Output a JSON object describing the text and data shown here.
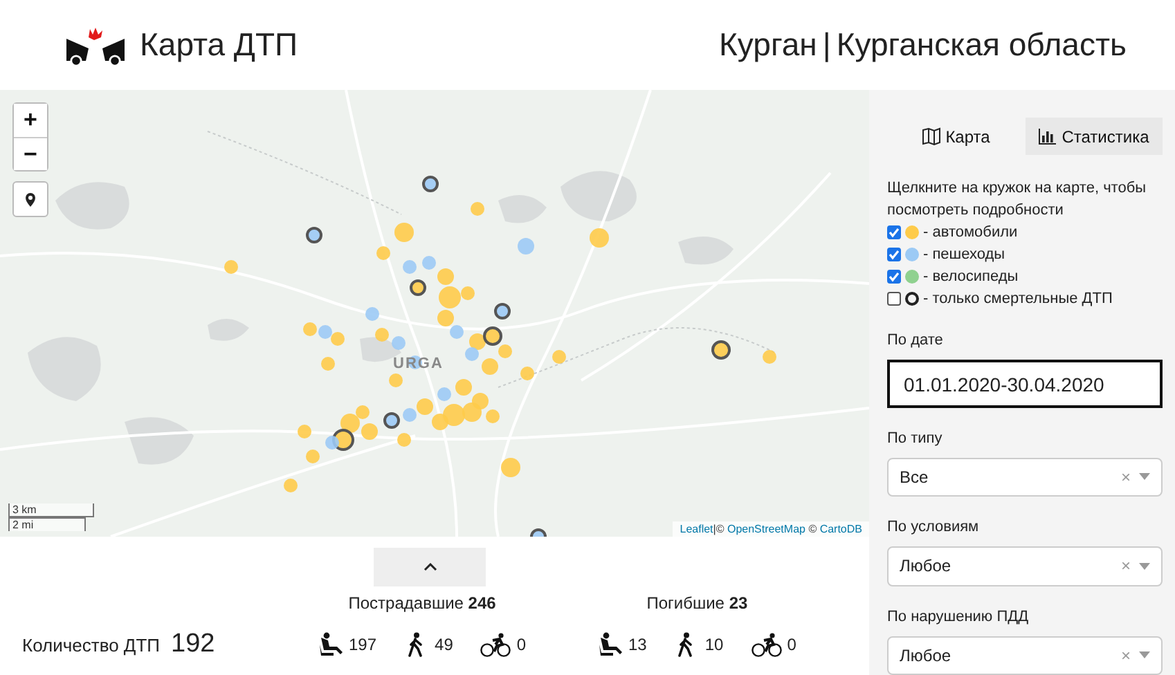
{
  "header": {
    "title": "Карта ДТП",
    "city": "Курган",
    "separator": "|",
    "region": "Курганская область"
  },
  "map": {
    "zoom_in": "+",
    "zoom_out": "−",
    "city_label": "URGA",
    "scale_metric": "3 km",
    "scale_imperial": "2 mi",
    "attribution": [
      {
        "text": "Leaflet",
        "kind": "link"
      },
      {
        "text": "|",
        "kind": "text"
      },
      {
        "text": "© ",
        "kind": "text"
      },
      {
        "text": "OpenStreetMap",
        "kind": "link"
      },
      {
        "text": " © ",
        "kind": "text"
      },
      {
        "text": "CartoDB",
        "kind": "link"
      }
    ]
  },
  "sidebar": {
    "tabs": [
      {
        "label": "Карта",
        "kind": "map",
        "selected": true
      },
      {
        "label": "Статистика",
        "kind": "chart",
        "selected": false
      }
    ],
    "hint": "Щелкните на кружок на карте, чтобы посмотреть подробности",
    "legend": [
      {
        "kind": "dot",
        "color": "#fecb4a",
        "label": "- автомобили",
        "checked": true
      },
      {
        "kind": "dot",
        "color": "#9ccaf5",
        "label": "- пешеходы",
        "checked": true
      },
      {
        "kind": "dot",
        "color": "#8fd18f",
        "label": "- велосипеды",
        "checked": true
      },
      {
        "kind": "ring",
        "color": "#222222",
        "label": "- только смертельные ДТП",
        "checked": false
      }
    ],
    "date_filter": {
      "label": "По дате",
      "value": "01.01.2020-30.04.2020"
    },
    "filters": [
      {
        "label": "По типу",
        "value": "Все",
        "clear": "×"
      },
      {
        "label": "По условиям",
        "value": "Любое",
        "clear": "×"
      },
      {
        "label": "По нарушению ПДД",
        "value": "Любое",
        "clear": "×"
      }
    ]
  },
  "stats": {
    "count_label": "Количество ДТП",
    "count": "192",
    "groups": [
      {
        "title": "Пострадавшие **246**",
        "items": [
          {
            "kind": "car",
            "value": "197"
          },
          {
            "kind": "pedestrian",
            "value": "49"
          },
          {
            "kind": "bicycle",
            "value": "0"
          }
        ]
      },
      {
        "title": "Погибшие **23**",
        "items": [
          {
            "kind": "car",
            "value": "13"
          },
          {
            "kind": "pedestrian",
            "value": "10"
          },
          {
            "kind": "bicycle",
            "value": "0"
          }
        ]
      }
    ]
  }
}
